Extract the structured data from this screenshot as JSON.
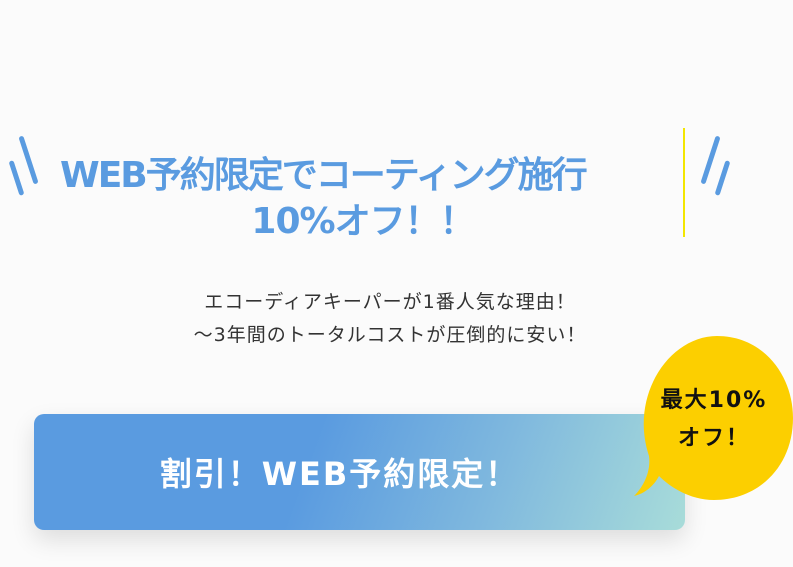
{
  "headline": {
    "line1": "WEB予約限定でコーティング施行",
    "line2": "10%オフ！！"
  },
  "subtext": {
    "line1": "エコーディアキーパーが1番人気な理由！",
    "line2": "～3年間のトータルコストが圧倒的に安い！"
  },
  "cta": {
    "label": "割引！WEB予約限定！"
  },
  "badge": {
    "line1": "最大10%",
    "line2": "オフ！"
  },
  "colors": {
    "accent": "#5a9be0",
    "gradient_end": "#a8dcd9",
    "badge": "#fccf00"
  }
}
